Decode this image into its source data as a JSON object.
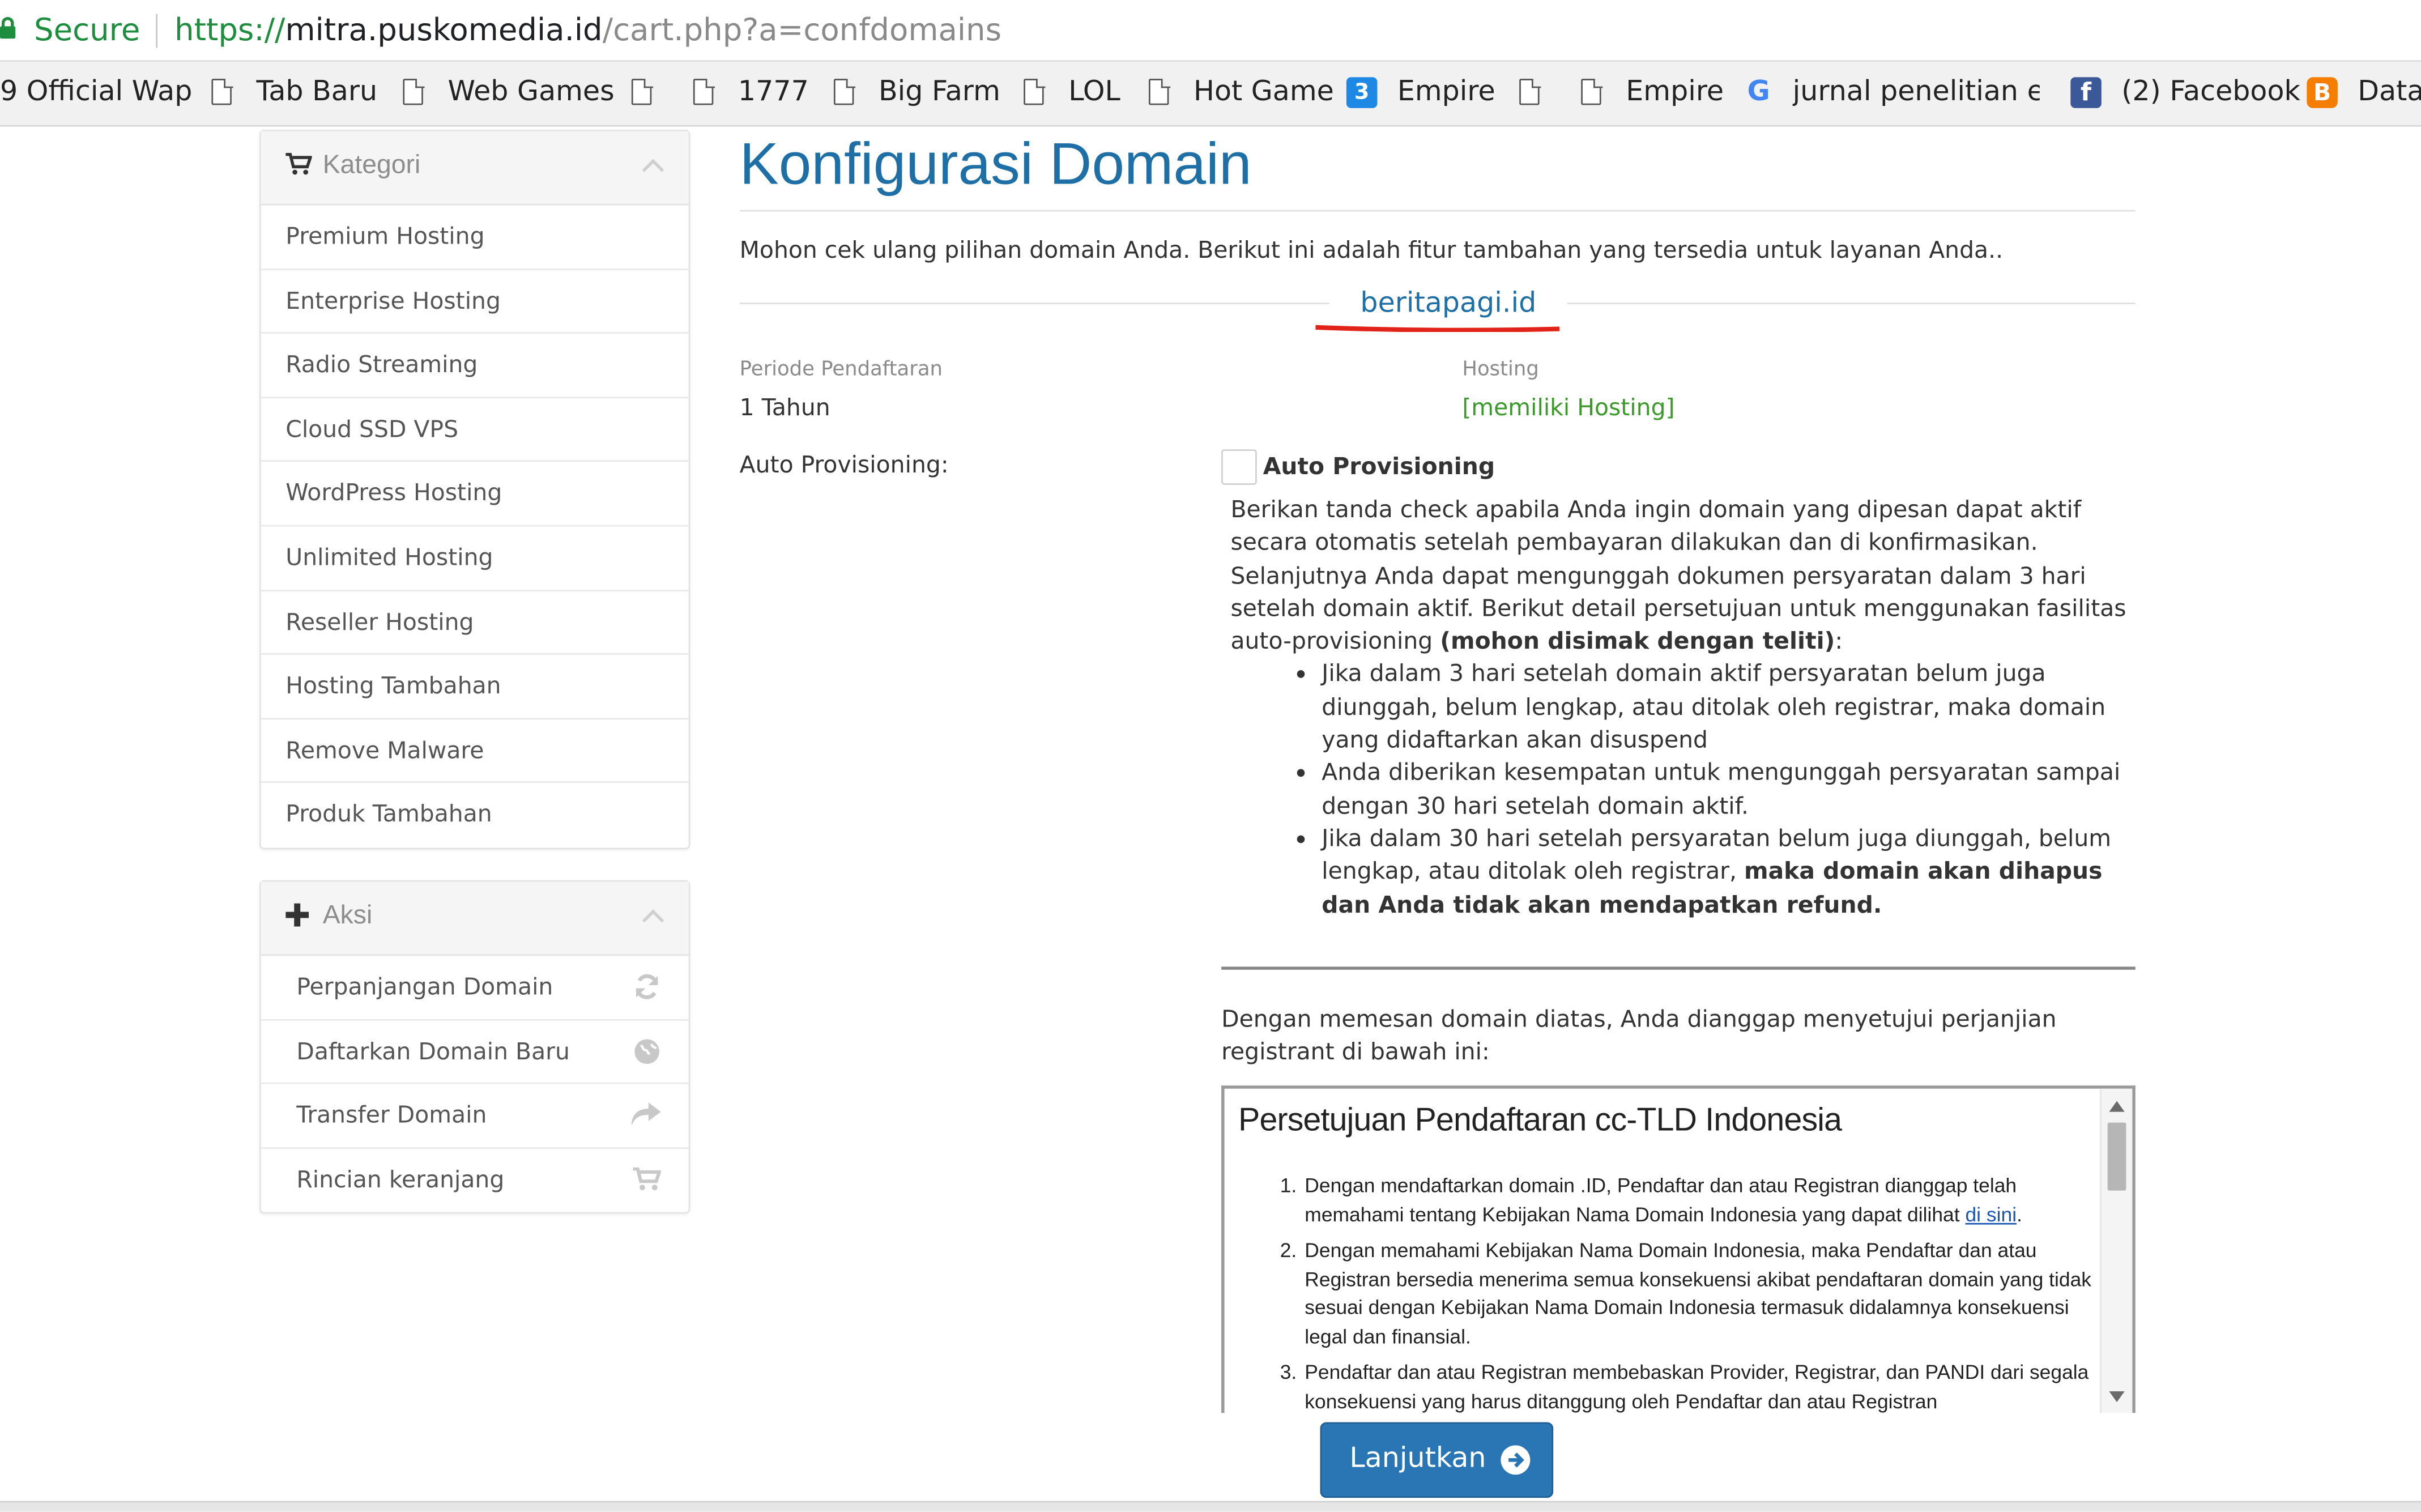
{
  "browser": {
    "secure_label": "Secure",
    "url_scheme": "https://",
    "url_host": "mitra.puskomedia.id",
    "url_path": "/cart.php?a=confdomains"
  },
  "bookmarks": [
    "9 Official Wap",
    "Tab Baru",
    "Web Games",
    "1777",
    "Big Farm",
    "LOL",
    "Hot Game",
    "Empire",
    "Empire",
    "jurnal penelitian eks",
    "(2) Facebook",
    "Datal"
  ],
  "sidebar": {
    "categories": {
      "title": "Kategori",
      "items": [
        "Premium Hosting",
        "Enterprise Hosting",
        "Radio Streaming",
        "Cloud SSD VPS",
        "WordPress Hosting",
        "Unlimited Hosting",
        "Reseller Hosting",
        "Hosting Tambahan",
        "Remove Malware",
        "Produk Tambahan"
      ]
    },
    "actions": {
      "title": "Aksi",
      "items": [
        "Perpanjangan Domain",
        "Daftarkan Domain Baru",
        "Transfer Domain",
        "Rincian keranjang"
      ]
    }
  },
  "main": {
    "title": "Konfigurasi Domain",
    "intro": "Mohon cek ulang pilihan domain Anda. Berikut ini adalah fitur tambahan yang tersedia untuk layanan Anda..",
    "domain": "beritapagi.id",
    "period_label": "Periode Pendaftaran",
    "period_value": "1 Tahun",
    "hosting_label": "Hosting",
    "hosting_value": "[memiliki Hosting]",
    "auto_label": "Auto Provisioning:",
    "auto_checkbox_label": "Auto Provisioning",
    "desc_p1": "Berikan tanda check apabila Anda ingin domain yang dipesan dapat aktif secara otomatis setelah pembayaran dilakukan dan di konfirmasikan.",
    "desc_p2a": "Selanjutnya Anda dapat mengunggah dokumen persyaratan dalam 3 hari setelah domain aktif. Berikut detail persetujuan untuk menggunakan fasilitas auto-provisioning ",
    "desc_p2b": "(mohon disimak dengan teliti)",
    "desc_p2c": ":",
    "bullet1": "Jika dalam 3 hari setelah domain aktif persyaratan belum juga diunggah, belum lengkap, atau ditolak oleh registrar, maka domain yang didaftarkan akan disuspend",
    "bullet2": "Anda diberikan kesempatan untuk mengunggah persyaratan sampai dengan 30 hari setelah domain aktif.",
    "bullet3a": "Jika dalam 30 hari setelah persyaratan belum juga diunggah, belum lengkap, atau ditolak oleh registrar, ",
    "bullet3b": "maka domain akan dihapus dan Anda tidak akan mendapatkan refund.",
    "agree_text": "Dengan memesan domain diatas, Anda dianggap menyetujui perjanjian registrant di bawah ini:",
    "tos": {
      "title": "Persetujuan Pendaftaran cc-TLD Indonesia",
      "item1": "Dengan mendaftarkan domain .ID, Pendaftar dan atau Registran dianggap telah memahami tentang Kebijakan Nama Domain Indonesia yang dapat dilihat ",
      "item1_link": "di sini",
      "item1_end": ".",
      "item2": "Dengan memahami Kebijakan Nama Domain Indonesia, maka Pendaftar dan atau Registran bersedia menerima semua konsekuensi akibat pendaftaran domain yang tidak sesuai dengan Kebijakan Nama Domain Indonesia termasuk didalamnya konsekuensi legal dan finansial.",
      "item3": "Pendaftar dan atau Registran membebaskan Provider, Registrar, dan PANDI dari segala konsekuensi yang harus ditanggung oleh Pendaftar dan atau Registran"
    },
    "continue_button": "Lanjutkan"
  }
}
